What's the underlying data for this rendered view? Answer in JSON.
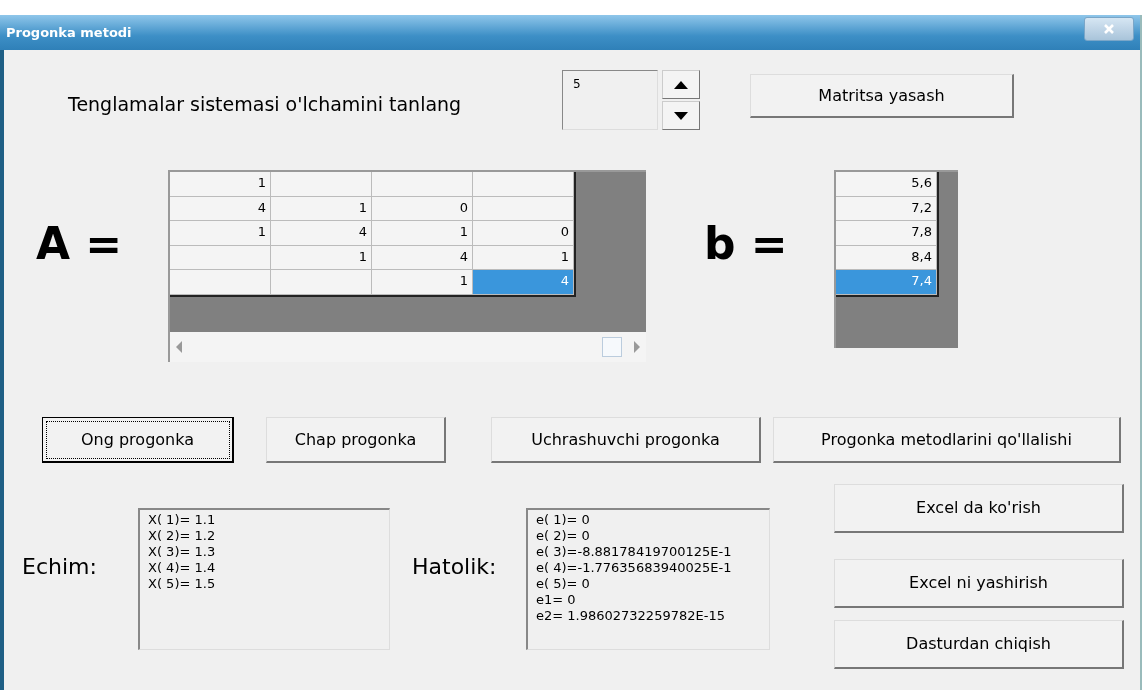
{
  "window": {
    "title": "Progonka metodi"
  },
  "size_selector": {
    "label": "Tenglamalar sistemasi o'lchamini tanlang",
    "value": "5"
  },
  "build_button": {
    "label": "Matritsa yasash"
  },
  "matrix_a": {
    "label": "A =",
    "rows": [
      [
        {
          "text": "1",
          "selected": false
        },
        {
          "selected": false
        },
        {
          "selected": false
        },
        {
          "selected": false
        }
      ],
      [
        {
          "text": "4",
          "selected": false
        },
        {
          "text": "1",
          "selected": false
        },
        {
          "text": "0",
          "selected": false
        },
        {
          "selected": false
        }
      ],
      [
        {
          "text": "1",
          "selected": false
        },
        {
          "text": "4",
          "selected": false
        },
        {
          "text": "1",
          "selected": false
        },
        {
          "text": "0",
          "selected": false
        }
      ],
      [
        {
          "selected": false
        },
        {
          "text": "1",
          "selected": false
        },
        {
          "text": "4",
          "selected": false
        },
        {
          "text": "1",
          "selected": false
        }
      ],
      [
        {
          "selected": false
        },
        {
          "selected": false
        },
        {
          "text": "1",
          "selected": false
        },
        {
          "text": "4",
          "selected": true
        }
      ]
    ]
  },
  "vector_b": {
    "label": "b =",
    "cells": [
      {
        "text": "5,6",
        "selected": false
      },
      {
        "text": "7,2",
        "selected": false
      },
      {
        "text": "7,8",
        "selected": false
      },
      {
        "text": "8,4",
        "selected": false
      },
      {
        "text": "7,4",
        "selected": true
      }
    ]
  },
  "method_buttons": [
    {
      "label": "Ong progonka",
      "focused": true
    },
    {
      "label": "Chap progonka",
      "focused": false
    },
    {
      "label": "Uchrashuvchi progonka",
      "focused": false
    },
    {
      "label": "Progonka metodlarini qo'llalishi",
      "focused": false
    }
  ],
  "solution": {
    "label": "Echim:",
    "lines": [
      "X( 1)= 1.1",
      "X( 2)= 1.2",
      "X( 3)= 1.3",
      "X( 4)= 1.4",
      "X( 5)= 1.5"
    ]
  },
  "error": {
    "label": "Hatolik:",
    "lines": [
      "e( 1)= 0",
      "e( 2)= 0",
      "e( 3)=-8.88178419700125E-1",
      "e( 4)=-1.77635683940025E-1",
      "e( 5)= 0",
      "e1= 0",
      "e2= 1.98602732259782E-15"
    ]
  },
  "side_buttons": [
    "Excel da ko'rish",
    "Excel ni yashirish",
    "Dasturdan chiqish"
  ]
}
